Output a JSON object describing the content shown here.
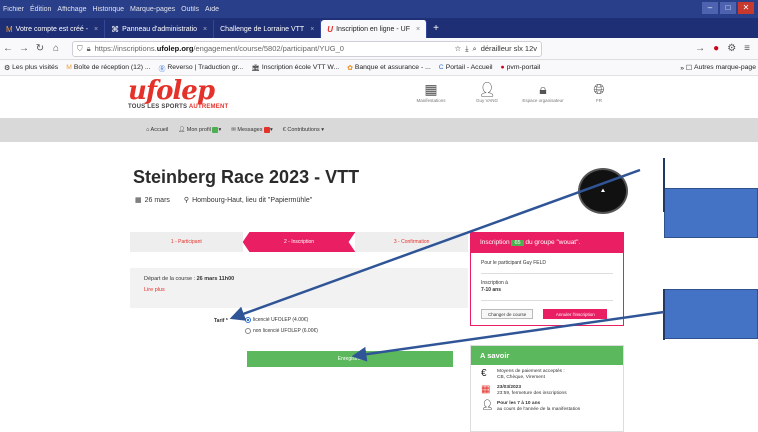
{
  "menubar": {
    "items": [
      "Fichier",
      "Édition",
      "Affichage",
      "Historique",
      "Marque-pages",
      "Outils",
      "Aide"
    ]
  },
  "tabs": [
    {
      "label": "Votre compte est créé - ",
      "icon": "mail-icon"
    },
    {
      "label": "Panneau d'administratio",
      "icon": "dashboard-icon"
    },
    {
      "label": "Challenge de Lorraine VTT",
      "icon": "page-icon"
    },
    {
      "label": "Inscription en ligne - UF",
      "icon": "ufolep-icon",
      "active": true
    }
  ],
  "url": {
    "prefix": "https://inscriptions.",
    "host": "ufolep.org",
    "path": "/engagement/course/5802/participant/YUG_0",
    "search": "dérailleur slx 12v"
  },
  "bookmarks": {
    "items": [
      "Les plus visités",
      "Boîte de réception (12) ...",
      "Reverso | Traduction gr...",
      "Inscription école VTT W...",
      "Banque et assurance - ...",
      "Portail - Accueil",
      "pvm-portail"
    ],
    "others": "Autres marque-page"
  },
  "site": {
    "logo": "ufolep",
    "tagline_1": "TOUS LES SPORTS",
    "tagline_2": "AUTREMENT",
    "links": [
      "Manifestations",
      "Guy VANG",
      "Espace organisateur",
      "FR"
    ]
  },
  "subnav": {
    "accueil": "Accueil",
    "profil": "Mon profil",
    "profil_badge": "",
    "messages": "Messages",
    "messages_badge": "",
    "contributions": "Contributions"
  },
  "event": {
    "title": "Steinberg Race 2023 - VTT",
    "date": "26 mars",
    "location": "Hombourg-Haut, lieu dit \"Papiermühle\""
  },
  "steps": [
    "1 - Participant",
    "2 - Inscription",
    "3 - Confirmation"
  ],
  "depart": {
    "label": "Départ de la course : ",
    "value": "26 mars 11h00",
    "more": "Lire plus"
  },
  "tarif": {
    "label": "Tarif *",
    "options": [
      {
        "label": "licencié UFOLEP (4.00€)",
        "checked": true
      },
      {
        "label": "non licencié UFOLEP (6.00€)",
        "checked": false
      }
    ],
    "submit": "Enregistrer"
  },
  "inscription": {
    "head_prefix": "Inscription",
    "head_num": "65",
    "head_suffix": "du groupe \"wouat\".",
    "participant": "Pour le participant Guy FELD",
    "category_label": "Inscription à",
    "category_value": "7-10 ans",
    "btn_change": "Changer de course",
    "btn_cancel": "Annuler l'inscription"
  },
  "asavoir": {
    "title": "A savoir",
    "items": [
      {
        "icon": "euro-icon",
        "line1": "Moyens de paiement acceptés :",
        "line2": "CB, Chèque, Virement"
      },
      {
        "icon": "calendar-icon",
        "line1": "23/03/2023",
        "line2": "23:59, fermeture des inscriptions"
      },
      {
        "icon": "person-icon",
        "line1": "Pour les 7 à 10 ans",
        "line2": "au cours de l'année de la manifestation"
      }
    ]
  },
  "colors": {
    "brand_red": "#e4322b",
    "step_pink": "#e91e63",
    "green": "#5cb85c",
    "annotation_blue": "#4472c4"
  }
}
